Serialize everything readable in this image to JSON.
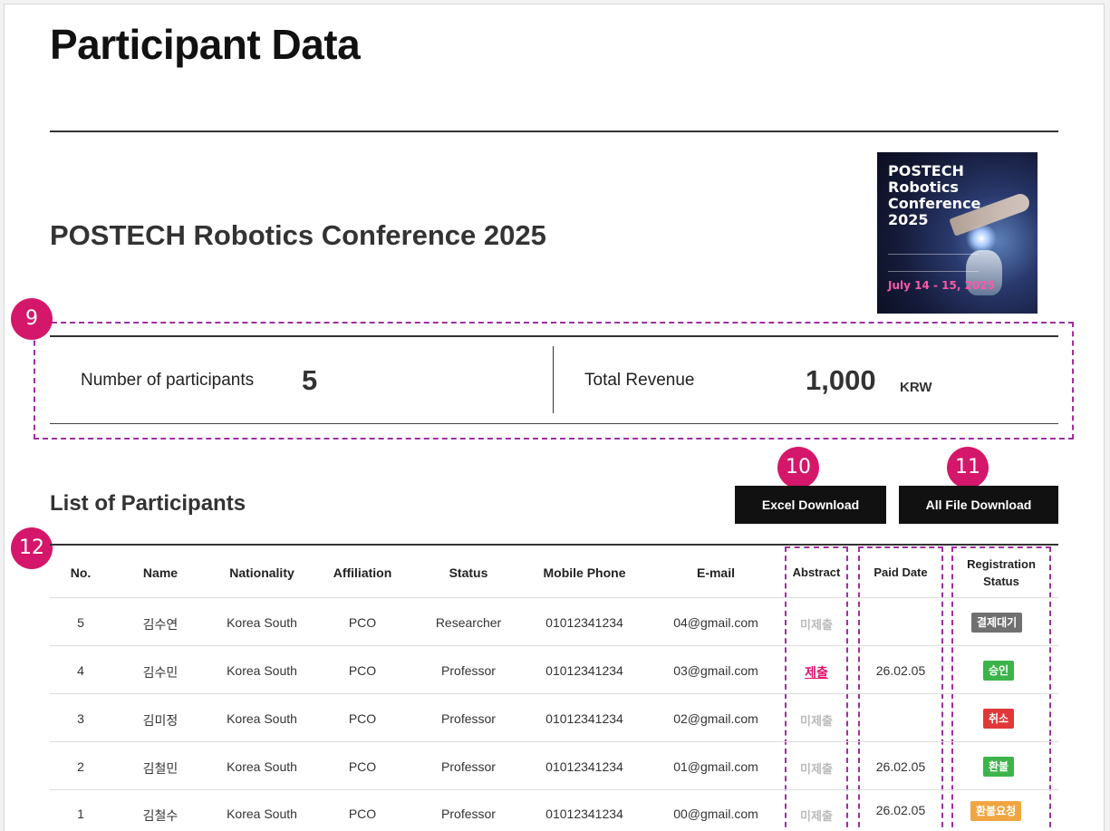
{
  "page_title": "Participant Data",
  "conference": {
    "title": "POSTECH Robotics Conference 2025",
    "poster": {
      "title": "POSTECH Robotics\nConference\n2025",
      "date": "July 14 - 15, 2025"
    }
  },
  "annotations": [
    "9",
    "10",
    "11",
    "12"
  ],
  "summary": {
    "participants_label": "Number of participants",
    "participants_value": "5",
    "revenue_label": "Total Revenue",
    "revenue_value": "1,000",
    "revenue_unit": "KRW"
  },
  "list_title": "List of Participants",
  "buttons": {
    "excel": "Excel Download",
    "all_files": "All File Download"
  },
  "table": {
    "headers": [
      "No.",
      "Name",
      "Nationality",
      "Affiliation",
      "Status",
      "Mobile Phone",
      "E-mail",
      "Abstract",
      "Paid Date",
      "Registration",
      "Status"
    ],
    "rows": [
      {
        "no": "5",
        "name": "김수연",
        "nationality": "Korea South",
        "affiliation": "PCO",
        "status": "Researcher",
        "phone": "01012341234",
        "email": "04@gmail.com",
        "abstract": "미제출",
        "paid": "",
        "reg": "결제대기"
      },
      {
        "no": "4",
        "name": "김수민",
        "nationality": "Korea South",
        "affiliation": "PCO",
        "status": "Professor",
        "phone": "01012341234",
        "email": "03@gmail.com",
        "abstract": "제출",
        "paid": "26.02.05",
        "reg": "승인"
      },
      {
        "no": "3",
        "name": "김미정",
        "nationality": "Korea South",
        "affiliation": "PCO",
        "status": "Professor",
        "phone": "01012341234",
        "email": "02@gmail.com",
        "abstract": "미제출",
        "paid": "",
        "reg": "취소"
      },
      {
        "no": "2",
        "name": "김철민",
        "nationality": "Korea South",
        "affiliation": "PCO",
        "status": "Professor",
        "phone": "01012341234",
        "email": "01@gmail.com",
        "abstract": "미제출",
        "paid": "26.02.05",
        "reg": "환불"
      },
      {
        "no": "1",
        "name": "김철수",
        "nationality": "Korea South",
        "affiliation": "PCO",
        "status": "Professor",
        "phone": "01012341234",
        "email": "00@gmail.com",
        "abstract": "미제출",
        "paid": "26.02.05",
        "reg": "환불요청"
      }
    ]
  },
  "colors": {
    "annotation_badge": "#d4176a",
    "annotation_border": "#a02fa0",
    "badge_pending": "#707070",
    "badge_approved": "#3db44a",
    "badge_cancelled": "#e03838",
    "badge_refunded": "#3db44a",
    "badge_refund_request": "#f0a640",
    "submitted_link": "#e0136c"
  }
}
